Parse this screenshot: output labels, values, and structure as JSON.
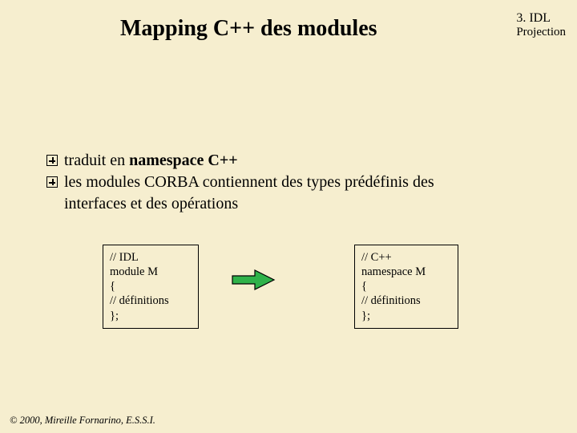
{
  "header": {
    "title": "Mapping C++ des modules",
    "topright_line1": "3. IDL",
    "topright_line2": "Projection"
  },
  "bullets": {
    "b1_pre": "traduit en ",
    "b1_strong": "namespace C++",
    "b2": "les modules CORBA contiennent des types prédéfinis des",
    "b2_cont": "interfaces et des opérations"
  },
  "code": {
    "idl": "// IDL\nmodule M\n{\n// définitions\n};",
    "cpp": "// C++\nnamespace M\n{\n// définitions\n};"
  },
  "arrow": {
    "name": "arrow-right-icon",
    "fill": "#2fb24a",
    "stroke": "#000000"
  },
  "footer": {
    "copyright": "© 2000, Mireille Fornarino, E.S.S.I."
  }
}
